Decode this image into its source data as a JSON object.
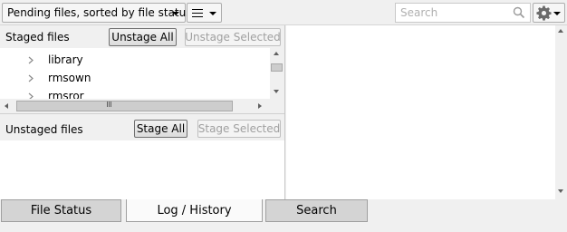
{
  "toolbar": {
    "sort_label": "Pending files, sorted by file status",
    "search_placeholder": "Search",
    "search_value": ""
  },
  "icons": {
    "view": "list-view-icon",
    "search": "magnifier-icon",
    "settings": "gear-icon"
  },
  "staged": {
    "label": "Staged files",
    "unstage_all": "Unstage All",
    "unstage_selected": "Unstage Selected",
    "items": [
      {
        "name": "library"
      },
      {
        "name": "rmsown"
      },
      {
        "name": "rmsror"
      }
    ]
  },
  "unstaged": {
    "label": "Unstaged files",
    "stage_all": "Stage All",
    "stage_selected": "Stage Selected"
  },
  "tabs": [
    {
      "label": "File Status"
    },
    {
      "label": "Log / History",
      "active": true
    },
    {
      "label": "Search"
    }
  ]
}
